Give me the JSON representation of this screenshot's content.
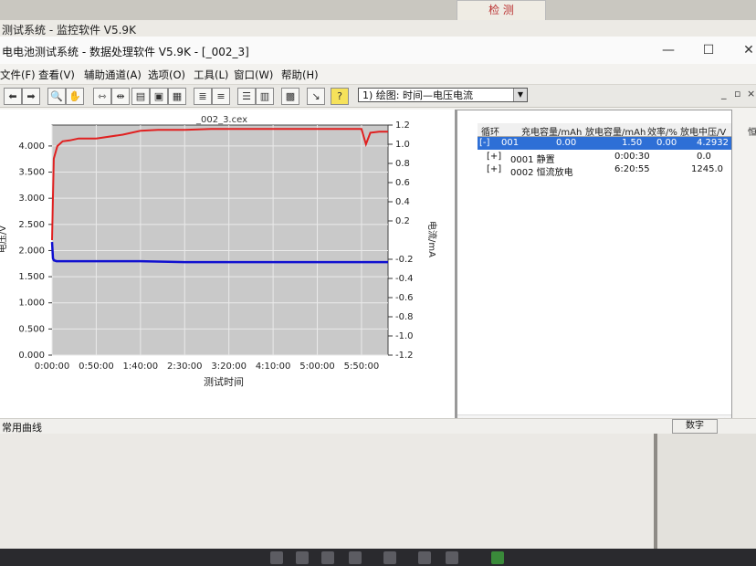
{
  "screen": {
    "outer_title": "测试系统 - 监控软件 V5.9K",
    "sticky_note": "检 测"
  },
  "app": {
    "title": "电电池测试系统 - 数据处理软件 V5.9K - [_002_3]",
    "window_buttons": [
      "—",
      "☐",
      "✕"
    ],
    "mdi_buttons": [
      "_",
      "▫",
      "×"
    ]
  },
  "menu": [
    "文件(F)",
    "查看(V)",
    "辅助通道(A)",
    "选项(O)",
    "工具(L)",
    "窗口(W)",
    "帮助(H)"
  ],
  "toolbar": {
    "dropdown_value": "1) 绘图: 时间—电压电流",
    "icons": [
      "back-arrow-icon",
      "forward-arrow-icon",
      "zoom-icon",
      "hand-icon",
      "x-zoom-in-icon",
      "x-zoom-out-icon",
      "table1-icon",
      "table2-icon",
      "table3-icon",
      "list1-icon",
      "list2-icon",
      "list3-icon",
      "list4-icon",
      "grid-icon",
      "export-icon",
      "help-icon"
    ]
  },
  "chart_data": {
    "type": "line",
    "title": "_002_3.cex",
    "xlabel": "测试时间",
    "ylabel": "电压/V",
    "y2label": "电流/mA",
    "x_ticks": [
      "0:00:00",
      "0:50:00",
      "1:40:00",
      "2:30:00",
      "3:20:00",
      "4:10:00",
      "5:00:00",
      "5:50:00"
    ],
    "y_ticks": [
      "0.000",
      "0.500",
      "1.000",
      "1.500",
      "2.000",
      "2.500",
      "3.000",
      "3.500",
      "4.000"
    ],
    "y2_ticks": [
      "-1.2",
      "-1.0",
      "-0.8",
      "-0.6",
      "-0.4",
      "-0.2",
      "0.2",
      "0.4",
      "0.6",
      "0.8",
      "1.0",
      "1.2"
    ],
    "ylim": [
      0,
      4.4
    ],
    "y2lim": [
      -1.2,
      1.2
    ],
    "x_unit": "minutes",
    "xlim": [
      0,
      380
    ],
    "series": [
      {
        "axis": "y2",
        "color": "#e02020",
        "x": [
          0,
          2,
          6,
          12,
          20,
          30,
          50,
          80,
          100,
          120,
          150,
          180,
          210,
          240,
          270,
          300,
          330,
          350,
          355,
          360,
          370,
          380
        ],
        "y": [
          0.0,
          0.85,
          0.98,
          1.03,
          1.04,
          1.06,
          1.06,
          1.1,
          1.14,
          1.15,
          1.15,
          1.16,
          1.16,
          1.16,
          1.16,
          1.16,
          1.16,
          1.16,
          1.0,
          1.12,
          1.13,
          1.13
        ]
      },
      {
        "axis": "y2",
        "color": "#1010d0",
        "x": [
          0,
          1,
          2,
          5,
          50,
          100,
          150,
          200,
          250,
          300,
          350,
          380
        ],
        "y": [
          -0.02,
          -0.19,
          -0.21,
          -0.22,
          -0.22,
          -0.22,
          -0.23,
          -0.23,
          -0.23,
          -0.23,
          -0.23,
          -0.23
        ]
      }
    ]
  },
  "table": {
    "headers": [
      "循环",
      "充电容量/mAh",
      "放电容量/mAh",
      "效率/%",
      "放电中压/V",
      "恒流"
    ],
    "rows": [
      {
        "toggle": "[-]",
        "id": "001",
        "charge": "0.00",
        "discharge": "1.50",
        "eff": "0.00",
        "vmid": "4.2932",
        "selected": true
      },
      {
        "toggle": "[+]",
        "id": "0001 静置",
        "charge": "",
        "discharge": "0:00:30",
        "eff": "",
        "vmid": "0.0",
        "selected": false
      },
      {
        "toggle": "[+]",
        "id": "0002 恒流放电",
        "charge": "",
        "discharge": "6:20:55",
        "eff": "",
        "vmid": "1245.0",
        "selected": false
      }
    ]
  },
  "status": {
    "left": "常用曲线",
    "right": "数字"
  }
}
